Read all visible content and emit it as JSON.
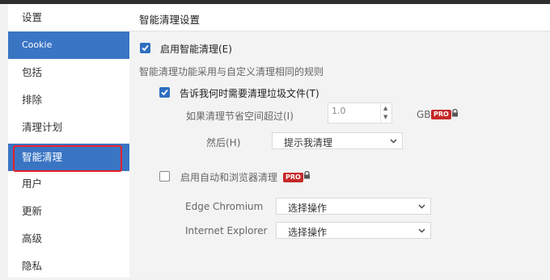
{
  "sidebar": {
    "items": [
      {
        "label": "设置"
      },
      {
        "label": "Cookie"
      },
      {
        "label": "包括"
      },
      {
        "label": "排除"
      },
      {
        "label": "清理计划"
      },
      {
        "label": "智能清理"
      },
      {
        "label": "用户"
      },
      {
        "label": "更新"
      },
      {
        "label": "高级"
      },
      {
        "label": "隐私"
      }
    ],
    "selected": "Cookie",
    "highlighted": "智能清理"
  },
  "main": {
    "title": "智能清理设置",
    "enable_smart": {
      "label": "启用智能清理(E)",
      "checked": true
    },
    "description": "智能清理功能采用与自定义清理相同的规则",
    "notify_junk": {
      "label": "告诉我何时需要清理垃圾文件(T)",
      "checked": true
    },
    "threshold": {
      "label": "如果清理节省空间超过(I)",
      "value": "1.0",
      "unit": "GB"
    },
    "then": {
      "label": "然后(H)",
      "selected": "提示我清理"
    },
    "auto_browser": {
      "label": "启用自动和浏览器清理",
      "checked": false
    },
    "browsers": [
      {
        "name": "Edge Chromium",
        "selected": "选择操作"
      },
      {
        "name": "Internet Explorer",
        "selected": "选择操作"
      }
    ],
    "pro_badge": "PRO"
  },
  "colors": {
    "accent": "#3a75c4",
    "pro": "#c62828",
    "highlight_frame": "#e8202a"
  }
}
